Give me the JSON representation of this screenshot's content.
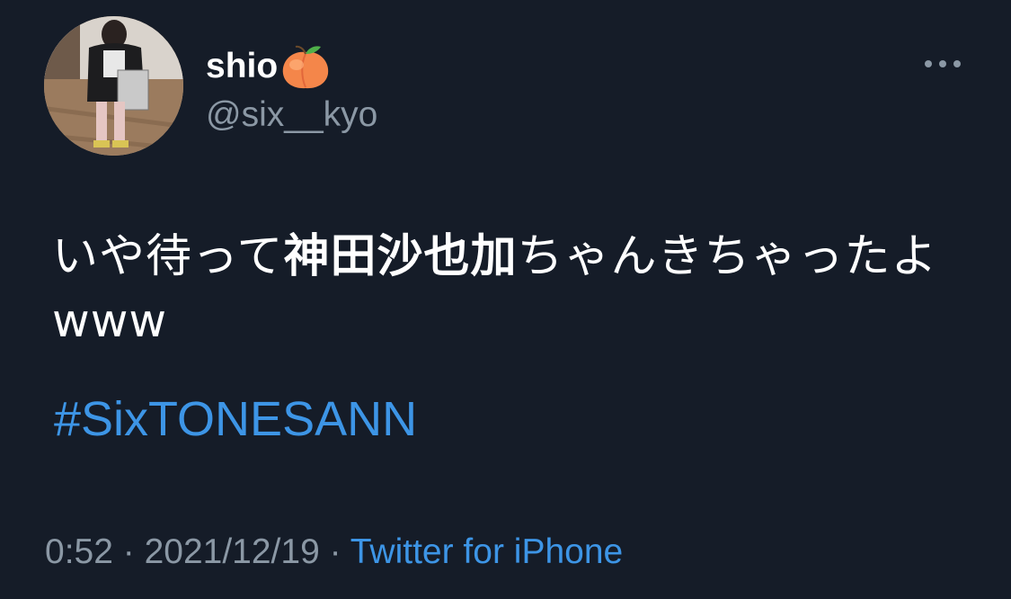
{
  "user": {
    "display_name": "shio",
    "display_name_emoji": "peach",
    "handle": "@six__kyo"
  },
  "tweet": {
    "text_part1": "いや待って",
    "text_bold": "神田沙也加",
    "text_part2": "ちゃんきちゃったよwww",
    "hashtag": "#SixTONESANN"
  },
  "meta": {
    "time": "0:52",
    "separator1": " · ",
    "date": "2021/12/19",
    "separator2": " · ",
    "source": "Twitter for iPhone"
  },
  "icons": {
    "more": "more-horizontal-icon",
    "emoji": "peach-icon"
  },
  "colors": {
    "background": "#151c28",
    "link": "#3d95e6",
    "secondary_text": "#8b98a5",
    "primary_text": "#ffffff"
  }
}
